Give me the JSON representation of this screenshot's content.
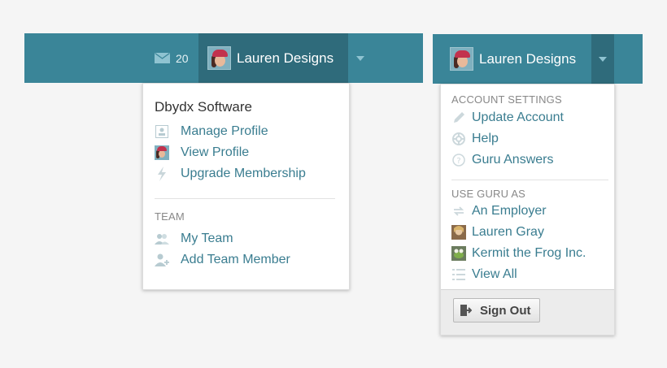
{
  "left": {
    "mail_count": "20",
    "user_name": "Lauren Designs",
    "menu": {
      "title": "Dbydx Software",
      "items": [
        {
          "label": "Manage Profile",
          "icon": "profile-card-icon"
        },
        {
          "label": "View Profile",
          "icon": "avatar"
        },
        {
          "label": "Upgrade Membership",
          "icon": "lightning-icon"
        }
      ],
      "team_section": "TEAM",
      "team_items": [
        {
          "label": "My Team",
          "icon": "team-icon"
        },
        {
          "label": "Add Team Member",
          "icon": "add-user-icon"
        }
      ]
    }
  },
  "right": {
    "user_name": "Lauren Designs",
    "menu": {
      "account_section": "ACCOUNT SETTINGS",
      "account_items": [
        {
          "label": "Update Account",
          "icon": "pencil-icon"
        },
        {
          "label": "Help",
          "icon": "lifebuoy-icon"
        },
        {
          "label": "Guru Answers",
          "icon": "question-icon"
        }
      ],
      "use_section": "USE GURU AS",
      "use_items": [
        {
          "label": "An Employer",
          "icon": "switch-icon"
        },
        {
          "label": "Lauren Gray",
          "icon": "photo-thumbnail"
        },
        {
          "label": "Kermit the Frog Inc.",
          "icon": "photo-thumbnail"
        },
        {
          "label": "View All",
          "icon": "list-icon"
        }
      ],
      "sign_out": "Sign Out"
    }
  },
  "colors": {
    "bar": "#3a8598",
    "bar_dark": "#2f6b7b",
    "link": "#3a7d90"
  }
}
